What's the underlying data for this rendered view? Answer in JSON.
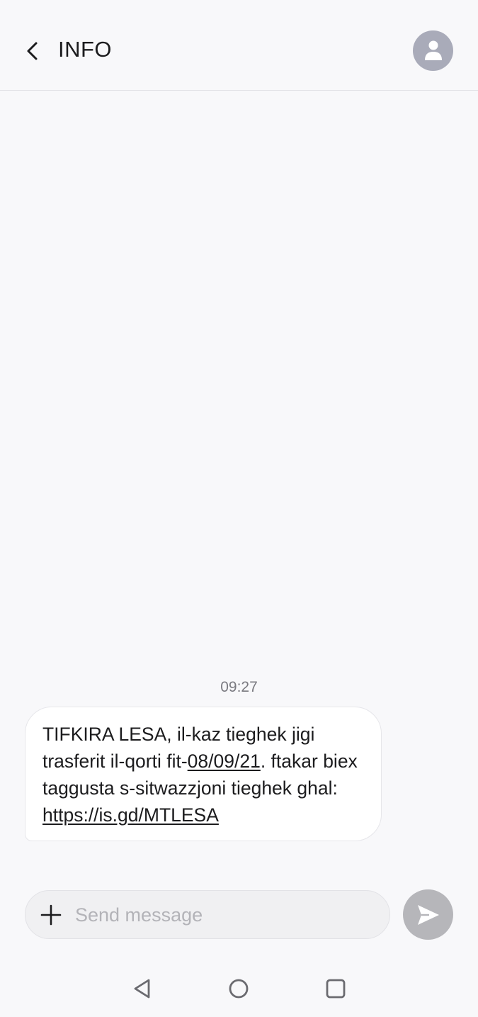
{
  "header": {
    "title": "INFO",
    "back_icon": "chevron-left-icon",
    "avatar_icon": "person-icon"
  },
  "conversation": {
    "timestamp": "09:27",
    "message": {
      "text_1": "TIFKIRA LESA, il-kaz tieghek jigi trasferit il-qorti fit-",
      "date_link": "08/09/21",
      "text_2": ". ftakar biex taggusta s-sitwazzjoni tieghek ghal: ",
      "url_link": "https://is.gd/MTLESA"
    }
  },
  "composer": {
    "placeholder": "Send message",
    "value": "",
    "attach_icon": "plus-icon",
    "send_icon": "send-icon"
  },
  "navbar": {
    "back_icon": "triangle-back-icon",
    "home_icon": "circle-home-icon",
    "recents_icon": "square-recents-icon"
  },
  "colors": {
    "background": "#f8f8fa",
    "bubble": "#ffffff",
    "avatar": "#a9abb9",
    "send_button": "#b6b6ba",
    "placeholder": "#b3b3b8"
  }
}
